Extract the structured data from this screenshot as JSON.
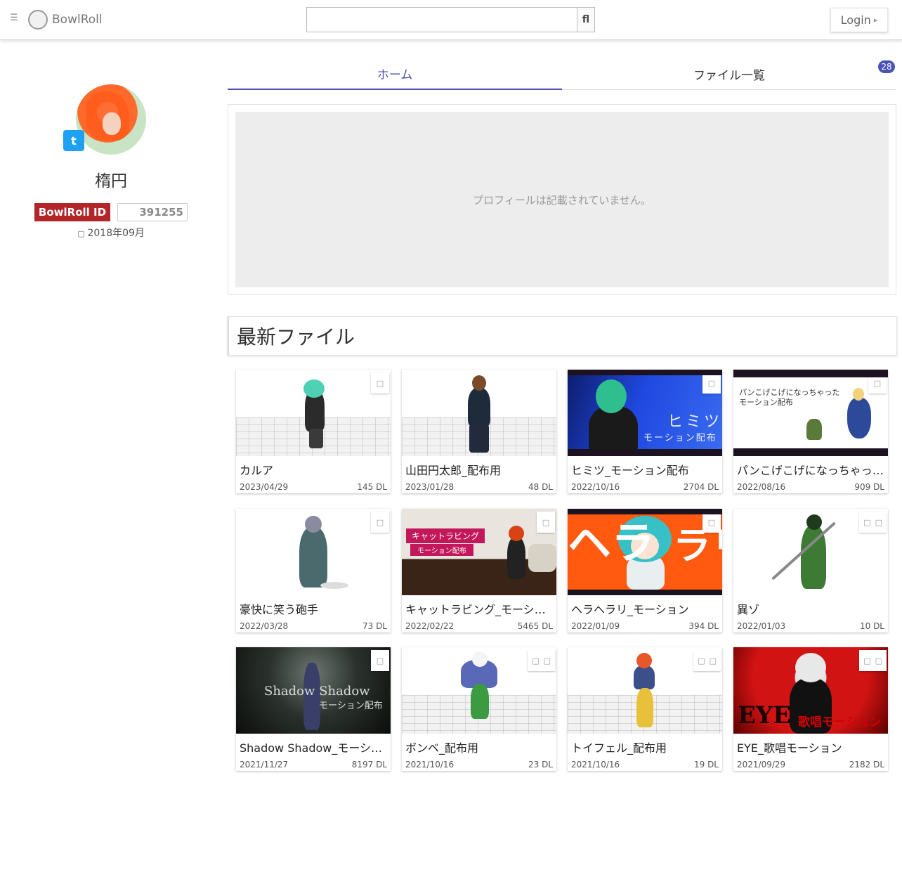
{
  "header": {
    "menu_icon": "☰",
    "logo_text": "BowlRoll",
    "search_value": "",
    "search_button": "fl",
    "login_label": "Login",
    "login_icon": "▸"
  },
  "profile": {
    "name": "楕円",
    "id_label": "BowlRoll ID",
    "id_value": "391255",
    "joined_icon": "▢",
    "joined": "2018年09月",
    "twitter_icon": "t"
  },
  "tabs": [
    {
      "label": "ホーム",
      "active": true
    },
    {
      "label": "ファイル一覧",
      "active": false
    }
  ],
  "tab_count": "28",
  "about_text": "プロフィールは記載されていません。",
  "section_title": "最新ファイル",
  "corner_icon": "□",
  "files": [
    {
      "title": "カルア",
      "date": "2023/04/29",
      "dl": "145 DL",
      "icons": 1,
      "thumb_text": "",
      "thumb_sub": ""
    },
    {
      "title": "山田円太郎_配布用",
      "date": "2023/01/28",
      "dl": "48 DL",
      "icons": 0,
      "thumb_text": "",
      "thumb_sub": ""
    },
    {
      "title": "ヒミツ_モーション配布",
      "date": "2022/10/16",
      "dl": "2704 DL",
      "icons": 1,
      "thumb_text": "ヒミツ",
      "thumb_sub": "モーション配布"
    },
    {
      "title": "パンこげこげになっちゃったモーション配布",
      "date": "2022/08/16",
      "dl": "909 DL",
      "icons": 1,
      "thumb_text": "パンこげこげになっちゃった",
      "thumb_sub": "モーション配布"
    },
    {
      "title": "豪快に笑う砲手",
      "date": "2022/03/28",
      "dl": "73 DL",
      "icons": 1,
      "thumb_text": "",
      "thumb_sub": ""
    },
    {
      "title": "キャットラビング_モーション配布",
      "date": "2022/02/22",
      "dl": "5465 DL",
      "icons": 1,
      "thumb_text": "キャットラビング",
      "thumb_sub": "モーション配布"
    },
    {
      "title": "ヘラヘラリ_モーション",
      "date": "2022/01/09",
      "dl": "394 DL",
      "icons": 1,
      "thumb_text": "ヘラ",
      "thumb_sub": "ラリ"
    },
    {
      "title": "異ゾ",
      "date": "2022/01/03",
      "dl": "10 DL",
      "icons": 2,
      "thumb_text": "",
      "thumb_sub": ""
    },
    {
      "title": "Shadow Shadow_モーション配布",
      "date": "2021/11/27",
      "dl": "8197 DL",
      "icons": 1,
      "thumb_text": "Shadow Shadow",
      "thumb_sub": "モーション配布"
    },
    {
      "title": "ボンベ_配布用",
      "date": "2021/10/16",
      "dl": "23 DL",
      "icons": 2,
      "thumb_text": "",
      "thumb_sub": ""
    },
    {
      "title": "トイフェル_配布用",
      "date": "2021/10/16",
      "dl": "19 DL",
      "icons": 2,
      "thumb_text": "",
      "thumb_sub": ""
    },
    {
      "title": "EYE_歌唱モーション",
      "date": "2021/09/29",
      "dl": "2182 DL",
      "icons": 2,
      "thumb_text": "EYE",
      "thumb_sub": "歌唱モーション"
    }
  ],
  "colors": {
    "accent": "#4a52b8",
    "id_badge": "#b2262a",
    "twitter": "#1da1f2"
  }
}
